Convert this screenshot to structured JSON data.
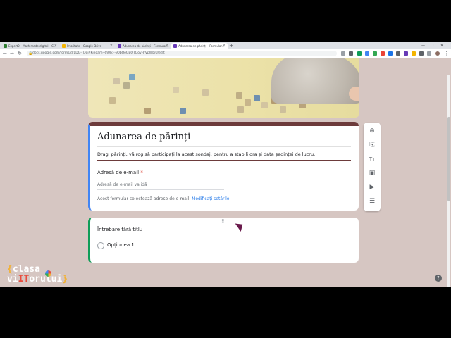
{
  "browser": {
    "tabs": [
      {
        "title": "Expert0 – Math made digital – C...",
        "color": "#2e7d32"
      },
      {
        "title": "Prioritate – Google Drive",
        "color": "#f4b400"
      },
      {
        "title": "Adunarea de părinți – Formular...",
        "color": "#673ab7"
      },
      {
        "title": "Adunarea de părinți – Formular...",
        "color": "#673ab7"
      }
    ],
    "new_tab": "+",
    "url": "docs.google.com/forms/d/1DG-TDoi7Kjeqam-Rh0lkF-90bQeGBOTOoyHrVpWbjU/edit"
  },
  "form": {
    "title": "Adunarea de părinți",
    "description": "Dragi părinți, vă rog să participați la acest sondaj, pentru a stabili ora și data ședinței de lucru.",
    "email_label": "Adresă de e-mail",
    "required_mark": "*",
    "email_placeholder": "Adresă de e-mail validă",
    "collect_notice": "Acest formular colectează adrese de e-mail.",
    "collect_link": "Modificați setările"
  },
  "question": {
    "drag_handle": "⠿",
    "title": "Întrebare fără titlu",
    "option_label": "Opțiunea 1"
  },
  "sidebar": {
    "icons": [
      "add-question-icon",
      "import-questions-icon",
      "add-title-icon",
      "add-image-icon",
      "add-video-icon",
      "add-section-icon"
    ],
    "glyphs": [
      "⊕",
      "⎘",
      "Tт",
      "▣",
      "▶",
      "☰"
    ]
  },
  "help": "?",
  "watermark": {
    "line1_open": "{",
    "line1_text": "clasa",
    "line2_a": "vi",
    "line2_it": "IT",
    "line2_b": "orului",
    "line2_close": "}",
    "small": "ASOCIAȚIA CLASA VIITORULUI"
  },
  "colors": {
    "form_accent": "#6d3b3b",
    "focus_bar_title": "#4285f4",
    "focus_bar_question": "#0f9d58",
    "page_background": "#d6c6c2"
  }
}
